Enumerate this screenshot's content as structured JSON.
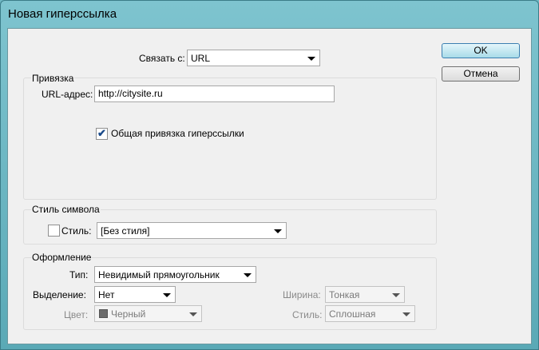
{
  "window": {
    "title": "Новая гиперссылка"
  },
  "link": {
    "label": "Связать с:",
    "value": "URL"
  },
  "anchor_group": {
    "title": "Привязка",
    "url_label": "URL-адрес:",
    "url_value": "http://citysite.ru",
    "shared_label": "Общая привязка гиперссылки",
    "shared_checked": true
  },
  "char_style_group": {
    "title": "Стиль символа",
    "style_label": "Стиль:",
    "style_value": "[Без стиля]",
    "style_checked": false
  },
  "appearance_group": {
    "title": "Оформление",
    "type_label": "Тип:",
    "type_value": "Невидимый прямоугольник",
    "highlight_label": "Выделение:",
    "highlight_value": "Нет",
    "color_label": "Цвет:",
    "color_value": "Черный",
    "color_swatch": "#6b6b6b",
    "width_label": "Ширина:",
    "width_value": "Тонкая",
    "style_label": "Стиль:",
    "style_value": "Сплошная"
  },
  "buttons": {
    "ok": "OK",
    "cancel": "Отмена"
  }
}
